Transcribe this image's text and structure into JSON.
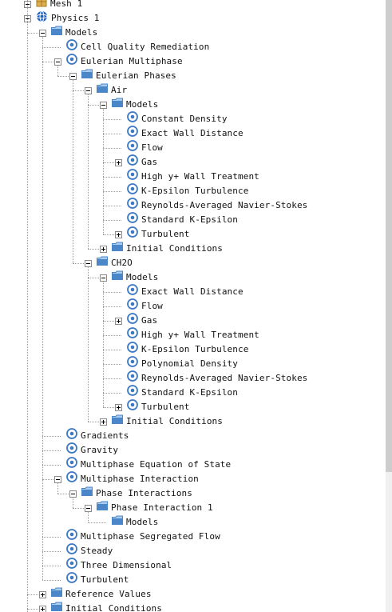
{
  "tree": [
    {
      "level": 0,
      "label": "Mesh 1",
      "icon": "mesh-icon",
      "expander": "minus"
    },
    {
      "level": 0,
      "label": "Physics 1",
      "icon": "physics-globe-icon",
      "expander": "minus"
    },
    {
      "level": 1,
      "label": "Models",
      "icon": "folder-icon",
      "expander": "minus"
    },
    {
      "level": 2,
      "label": "Cell Quality Remediation",
      "icon": "model-node-icon",
      "expander": "none"
    },
    {
      "level": 2,
      "label": "Eulerian Multiphase",
      "icon": "model-node-icon",
      "expander": "minus"
    },
    {
      "level": 3,
      "label": "Eulerian Phases",
      "icon": "folder-icon",
      "expander": "minus"
    },
    {
      "level": 4,
      "label": "Air",
      "icon": "folder-icon",
      "expander": "minus"
    },
    {
      "level": 5,
      "label": "Models",
      "icon": "folder-icon",
      "expander": "minus"
    },
    {
      "level": 6,
      "label": "Constant Density",
      "icon": "model-node-icon",
      "expander": "none"
    },
    {
      "level": 6,
      "label": "Exact Wall Distance",
      "icon": "model-node-icon",
      "expander": "none"
    },
    {
      "level": 6,
      "label": "Flow",
      "icon": "model-node-icon",
      "expander": "none"
    },
    {
      "level": 6,
      "label": "Gas",
      "icon": "model-node-icon",
      "expander": "plus"
    },
    {
      "level": 6,
      "label": "High y+ Wall Treatment",
      "icon": "model-node-icon",
      "expander": "none"
    },
    {
      "level": 6,
      "label": "K-Epsilon Turbulence",
      "icon": "model-node-icon",
      "expander": "none"
    },
    {
      "level": 6,
      "label": "Reynolds-Averaged Navier-Stokes",
      "icon": "model-node-icon",
      "expander": "none"
    },
    {
      "level": 6,
      "label": "Standard K-Epsilon",
      "icon": "model-node-icon",
      "expander": "none"
    },
    {
      "level": 6,
      "label": "Turbulent",
      "icon": "model-node-icon",
      "expander": "plus"
    },
    {
      "level": 5,
      "label": "Initial Conditions",
      "icon": "folder-icon",
      "expander": "plus"
    },
    {
      "level": 4,
      "label": "CH2O",
      "icon": "folder-icon",
      "expander": "minus"
    },
    {
      "level": 5,
      "label": "Models",
      "icon": "folder-icon",
      "expander": "minus"
    },
    {
      "level": 6,
      "label": "Exact Wall Distance",
      "icon": "model-node-icon",
      "expander": "none"
    },
    {
      "level": 6,
      "label": "Flow",
      "icon": "model-node-icon",
      "expander": "none"
    },
    {
      "level": 6,
      "label": "Gas",
      "icon": "model-node-icon",
      "expander": "plus"
    },
    {
      "level": 6,
      "label": "High y+ Wall Treatment",
      "icon": "model-node-icon",
      "expander": "none"
    },
    {
      "level": 6,
      "label": "K-Epsilon Turbulence",
      "icon": "model-node-icon",
      "expander": "none"
    },
    {
      "level": 6,
      "label": "Polynomial Density",
      "icon": "model-node-icon",
      "expander": "none"
    },
    {
      "level": 6,
      "label": "Reynolds-Averaged Navier-Stokes",
      "icon": "model-node-icon",
      "expander": "none"
    },
    {
      "level": 6,
      "label": "Standard K-Epsilon",
      "icon": "model-node-icon",
      "expander": "none"
    },
    {
      "level": 6,
      "label": "Turbulent",
      "icon": "model-node-icon",
      "expander": "plus"
    },
    {
      "level": 5,
      "label": "Initial Conditions",
      "icon": "folder-icon",
      "expander": "plus"
    },
    {
      "level": 2,
      "label": "Gradients",
      "icon": "model-node-icon",
      "expander": "none"
    },
    {
      "level": 2,
      "label": "Gravity",
      "icon": "model-node-icon",
      "expander": "none"
    },
    {
      "level": 2,
      "label": "Multiphase Equation of State",
      "icon": "model-node-icon",
      "expander": "none"
    },
    {
      "level": 2,
      "label": "Multiphase Interaction",
      "icon": "model-node-icon",
      "expander": "minus"
    },
    {
      "level": 3,
      "label": "Phase Interactions",
      "icon": "folder-icon",
      "expander": "minus"
    },
    {
      "level": 4,
      "label": "Phase Interaction 1",
      "icon": "folder-icon",
      "expander": "minus"
    },
    {
      "level": 5,
      "label": "Models",
      "icon": "folder-icon",
      "expander": "none"
    },
    {
      "level": 2,
      "label": "Multiphase Segregated Flow",
      "icon": "model-node-icon",
      "expander": "none"
    },
    {
      "level": 2,
      "label": "Steady",
      "icon": "model-node-icon",
      "expander": "none"
    },
    {
      "level": 2,
      "label": "Three Dimensional",
      "icon": "model-node-icon",
      "expander": "none"
    },
    {
      "level": 2,
      "label": "Turbulent",
      "icon": "model-node-icon",
      "expander": "none"
    },
    {
      "level": 1,
      "label": "Reference Values",
      "icon": "folder-icon",
      "expander": "plus"
    },
    {
      "level": 1,
      "label": "Initial Conditions",
      "icon": "folder-icon",
      "expander": "plus"
    }
  ],
  "colors": {
    "folder": "#4a86c8",
    "folder_light": "#a9cdef",
    "node_ring": "#3c78c3",
    "globe": "#1f63c7",
    "guide_line": "#9a9a9a",
    "scrollbar_track": "#f0f0f0",
    "scrollbar_thumb": "#cdcdcd"
  }
}
